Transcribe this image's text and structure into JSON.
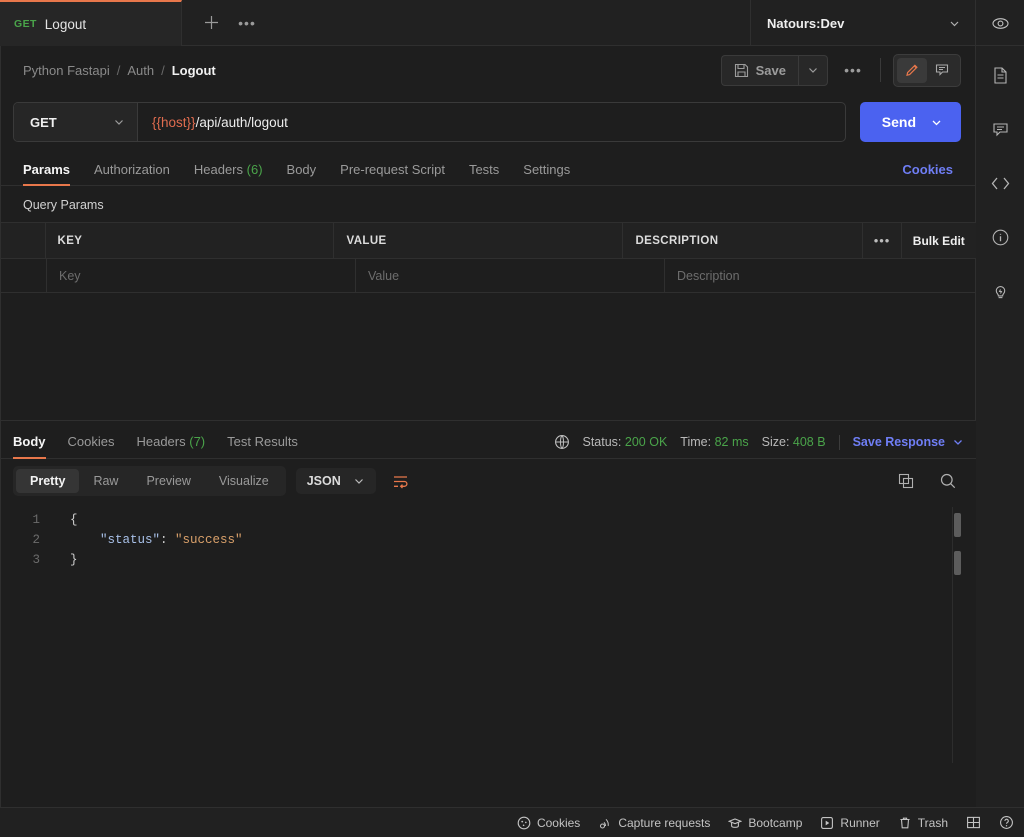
{
  "tabbar": {
    "request_tab": {
      "method": "GET",
      "name": "Logout"
    },
    "new_tab_label": "+",
    "tab_menu_label": "•••",
    "environment": {
      "name": "Natours:Dev"
    },
    "eye_icon": "eye-icon"
  },
  "breadcrumb": {
    "items": [
      "Python Fastapi",
      "Auth",
      "Logout"
    ],
    "separator": "/"
  },
  "toolbar": {
    "save_label": "Save",
    "more_label": "•••",
    "edit_icon": "pencil-icon",
    "comment_icon": "comment-icon"
  },
  "request": {
    "method": "GET",
    "url_variable": "{{host}}",
    "url_path": "/api/auth/logout",
    "send_label": "Send"
  },
  "request_tabs": [
    {
      "label": "Params",
      "count": null,
      "active": true
    },
    {
      "label": "Authorization",
      "count": null,
      "active": false
    },
    {
      "label": "Headers",
      "count": "(6)",
      "active": false
    },
    {
      "label": "Body",
      "count": null,
      "active": false
    },
    {
      "label": "Pre-request Script",
      "count": null,
      "active": false
    },
    {
      "label": "Tests",
      "count": null,
      "active": false
    },
    {
      "label": "Settings",
      "count": null,
      "active": false
    }
  ],
  "cookies_link": "Cookies",
  "query_params": {
    "title": "Query Params",
    "columns": [
      "KEY",
      "VALUE",
      "DESCRIPTION"
    ],
    "row_menu_label": "•••",
    "bulk_edit_label": "Bulk Edit",
    "placeholder_row": {
      "key": "Key",
      "value": "Value",
      "description": "Description"
    }
  },
  "response": {
    "tabs": [
      {
        "label": "Body",
        "count": null,
        "active": true
      },
      {
        "label": "Cookies",
        "count": null,
        "active": false
      },
      {
        "label": "Headers",
        "count": "(7)",
        "active": false
      },
      {
        "label": "Test Results",
        "count": null,
        "active": false
      }
    ],
    "status": {
      "label": "Status:",
      "value": "200 OK"
    },
    "time": {
      "label": "Time:",
      "value": "82 ms"
    },
    "size": {
      "label": "Size:",
      "value": "408 B"
    },
    "save_response_label": "Save Response",
    "globe_icon": "globe-icon",
    "format_pills": [
      {
        "label": "Pretty",
        "active": true
      },
      {
        "label": "Raw",
        "active": false
      },
      {
        "label": "Preview",
        "active": false
      },
      {
        "label": "Visualize",
        "active": false
      }
    ],
    "language": "JSON",
    "wrap_icon": "word-wrap-icon",
    "copy_icon": "copy-icon",
    "search_icon": "search-icon",
    "body_lines": [
      {
        "no": "1",
        "open_brace": "{"
      },
      {
        "no": "2",
        "key": "\"status\"",
        "colon": ": ",
        "value": "\"success\""
      },
      {
        "no": "3",
        "close_brace": "}"
      }
    ]
  },
  "rail_icons": [
    "documentation-icon",
    "comment-icon",
    "code-icon",
    "info-icon",
    "lightbulb-icon"
  ],
  "footer": {
    "items": [
      {
        "label": "Cookies",
        "icon": "cookie-icon"
      },
      {
        "label": "Capture requests",
        "icon": "satellite-icon"
      },
      {
        "label": "Bootcamp",
        "icon": "graduation-cap-icon"
      },
      {
        "label": "Runner",
        "icon": "runner-icon"
      },
      {
        "label": "Trash",
        "icon": "trash-icon"
      }
    ],
    "layout_icon": "layout-icon",
    "help_icon": "help-icon"
  },
  "colors": {
    "accent_orange": "#e8774b",
    "send_blue": "#4b62f0",
    "link_blue": "#6f7ef5",
    "success_green": "#4aa44a",
    "background": "#1e1e1e"
  }
}
